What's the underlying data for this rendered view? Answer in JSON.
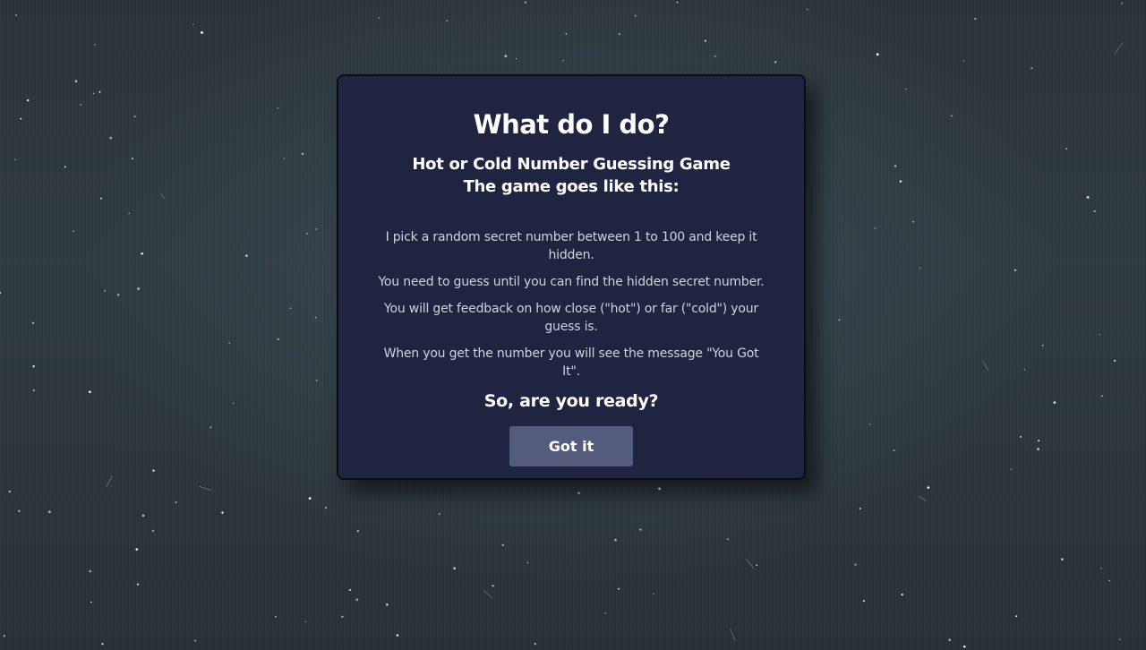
{
  "modal": {
    "title": "What do I do?",
    "subtitle_line1": "Hot or Cold Number Guessing Game",
    "subtitle_line2": "The game goes like this:",
    "rules": [
      "I pick a random secret number between 1 to 100 and keep it hidden.",
      "You need to guess until you can find the hidden secret number.",
      "You will get feedback on how close (\"hot\") or far (\"cold\") your guess is.",
      "When you get the number you will see the message \"You Got It\"."
    ],
    "prompt": "So, are you ready?",
    "button_label": "Got it"
  },
  "colors": {
    "modal_background": "#1f2540",
    "button_background": "#545c7e",
    "page_background": "#2f3a41"
  }
}
